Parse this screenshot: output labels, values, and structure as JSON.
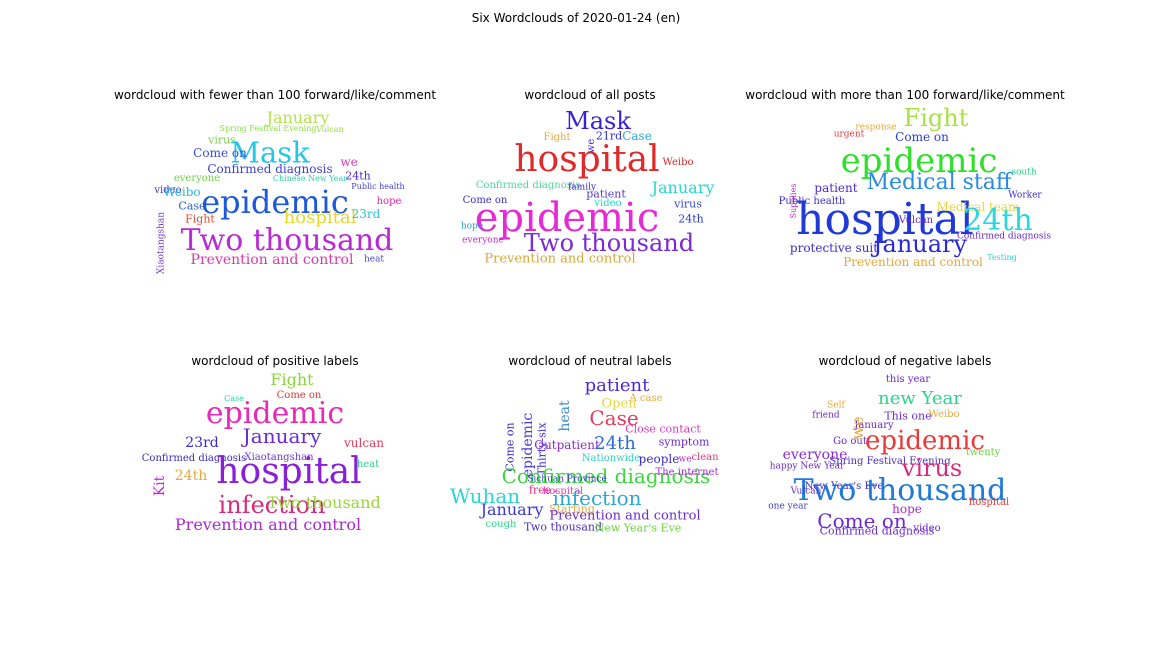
{
  "figure_title": "Six Wordclouds of 2020-01-24 (en)",
  "panels": [
    {
      "title": "wordcloud with fewer than 100 forward/like/comment",
      "words": [
        {
          "text": "January",
          "color": "#b5e34a"
        },
        {
          "text": "Spring Festival Evening",
          "color": "#8be04a"
        },
        {
          "text": "Vulcan",
          "color": "#9be03c"
        },
        {
          "text": "virus",
          "color": "#7ed050"
        },
        {
          "text": "Mask",
          "color": "#22c7e6"
        },
        {
          "text": "Come on",
          "color": "#3a4bd8"
        },
        {
          "text": "Confirmed diagnosis",
          "color": "#3b3fd0"
        },
        {
          "text": "video",
          "color": "#3c2fd0"
        },
        {
          "text": "everyone",
          "color": "#6fd64a"
        },
        {
          "text": "Weibo",
          "color": "#26b8e8"
        },
        {
          "text": "Case",
          "color": "#2a62d6"
        },
        {
          "text": "epidemic",
          "color": "#1f58d8"
        },
        {
          "text": "24th",
          "color": "#4a2bd0"
        },
        {
          "text": "Public health",
          "color": "#3f3fc8"
        },
        {
          "text": "Chinese New Year",
          "color": "#2ed0a8"
        },
        {
          "text": "Fight",
          "color": "#e64a2e"
        },
        {
          "text": "hospital",
          "color": "#e8d62a"
        },
        {
          "text": "23rd",
          "color": "#2fc2d8"
        },
        {
          "text": "hope",
          "color": "#e62aa8"
        },
        {
          "text": "Two thousand",
          "color": "#b82ad6"
        },
        {
          "text": "Prevention and control",
          "color": "#d83aa8"
        },
        {
          "text": "Xiaotangshan",
          "color": "#6a3ad0"
        },
        {
          "text": "we",
          "color": "#d83ab8"
        },
        {
          "text": "heat",
          "color": "#4a4ad0"
        }
      ]
    },
    {
      "title": "wordcloud of all posts",
      "words": [
        {
          "text": "Mask",
          "color": "#3a1fd8"
        },
        {
          "text": "Fight",
          "color": "#e8a83a"
        },
        {
          "text": "21rd",
          "color": "#2a2ad8"
        },
        {
          "text": "Case",
          "color": "#2aa8e0"
        },
        {
          "text": "hospital",
          "color": "#e02a2a"
        },
        {
          "text": "Weibo",
          "color": "#e02a2a"
        },
        {
          "text": "Confirmed diagnosis",
          "color": "#4ad89a"
        },
        {
          "text": "patient",
          "color": "#5a3ad0"
        },
        {
          "text": "January",
          "color": "#2ad6d0"
        },
        {
          "text": "Come on",
          "color": "#3a2ad0"
        },
        {
          "text": "virus",
          "color": "#3a4ad8"
        },
        {
          "text": "epidemic",
          "color": "#e62ad6"
        },
        {
          "text": "24th",
          "color": "#2a3ad0"
        },
        {
          "text": "hope",
          "color": "#2a9ad8"
        },
        {
          "text": "everyone",
          "color": "#c82ad6"
        },
        {
          "text": "Two thousand",
          "color": "#7a2ad8"
        },
        {
          "text": "Prevention and control",
          "color": "#d8a83a"
        },
        {
          "text": "video",
          "color": "#2ad6c0"
        },
        {
          "text": "we",
          "color": "#4a2ad0"
        },
        {
          "text": "family",
          "color": "#3a2ad0"
        }
      ]
    },
    {
      "title": "wordcloud with more than 100 forward/like/comment",
      "words": [
        {
          "text": "Fight",
          "color": "#a8e04a"
        },
        {
          "text": "response",
          "color": "#e8a83a"
        },
        {
          "text": "urgent",
          "color": "#e83a3a"
        },
        {
          "text": "Come on",
          "color": "#2a3ad8"
        },
        {
          "text": "epidemic",
          "color": "#2ee02a"
        },
        {
          "text": "patient",
          "color": "#4a2ad8"
        },
        {
          "text": "Medical staff",
          "color": "#2a8ae0"
        },
        {
          "text": "Public health",
          "color": "#3a2ad0"
        },
        {
          "text": "hospital",
          "color": "#1f3ad8"
        },
        {
          "text": "Vulcan",
          "color": "#5a2ad0"
        },
        {
          "text": "Medical team",
          "color": "#e8d63a"
        },
        {
          "text": "24th",
          "color": "#2ad6e0"
        },
        {
          "text": "January",
          "color": "#2a2ad8"
        },
        {
          "text": "protective suit",
          "color": "#3a2ad0"
        },
        {
          "text": "Prevention and control",
          "color": "#e8a83a"
        },
        {
          "text": "Worker",
          "color": "#3a2ad0"
        },
        {
          "text": "Testing",
          "color": "#2ad6d0"
        },
        {
          "text": "south",
          "color": "#2ad68a"
        },
        {
          "text": "Supplies",
          "color": "#c82ad6"
        },
        {
          "text": "Confirmed diagnosis",
          "color": "#6a2ad0"
        }
      ]
    },
    {
      "title": "wordcloud of positive labels",
      "words": [
        {
          "text": "Fight",
          "color": "#8ad63a"
        },
        {
          "text": "Come on",
          "color": "#d83a3a"
        },
        {
          "text": "Case",
          "color": "#2ad6a8"
        },
        {
          "text": "epidemic",
          "color": "#e82ab8"
        },
        {
          "text": "January",
          "color": "#6a2ad8"
        },
        {
          "text": "23rd",
          "color": "#3a2ad0"
        },
        {
          "text": "vulcan",
          "color": "#e83a5a"
        },
        {
          "text": "Xiaotangshan",
          "color": "#6a3ad0"
        },
        {
          "text": "Confirmed diagnosis",
          "color": "#3a2ad0"
        },
        {
          "text": "24th",
          "color": "#e8a83a"
        },
        {
          "text": "hospital",
          "color": "#8a1fd8"
        },
        {
          "text": "Kit",
          "color": "#b82ad6"
        },
        {
          "text": "infection",
          "color": "#d82a7a"
        },
        {
          "text": "Two thousand",
          "color": "#9ad63a"
        },
        {
          "text": "Prevention and control",
          "color": "#a82ad6"
        },
        {
          "text": "heat",
          "color": "#2ad68a"
        }
      ]
    },
    {
      "title": "wordcloud of neutral labels",
      "words": [
        {
          "text": "patient",
          "color": "#4a2ad8"
        },
        {
          "text": "Open",
          "color": "#e8d63a"
        },
        {
          "text": "A case",
          "color": "#e8a83a"
        },
        {
          "text": "heat",
          "color": "#3a8ad0"
        },
        {
          "text": "epidemic",
          "color": "#4a3ad8"
        },
        {
          "text": "Thirty-six",
          "color": "#3a2ad0"
        },
        {
          "text": "Case",
          "color": "#e83a5a"
        },
        {
          "text": "Outpatient",
          "color": "#8a2ad6"
        },
        {
          "text": "Close contact",
          "color": "#d83ab8"
        },
        {
          "text": "24th",
          "color": "#2a6ad8"
        },
        {
          "text": "symptom",
          "color": "#6a2ad8"
        },
        {
          "text": "Come on",
          "color": "#3a2ad0"
        },
        {
          "text": "Nationwide",
          "color": "#2ad6c0"
        },
        {
          "text": "people",
          "color": "#3a2ad0"
        },
        {
          "text": "we",
          "color": "#b82ad6"
        },
        {
          "text": "clean",
          "color": "#e83a7a"
        },
        {
          "text": "Confirmed diagnosis",
          "color": "#3ad83a"
        },
        {
          "text": "The internet",
          "color": "#a82ad6"
        },
        {
          "text": "free",
          "color": "#e82a8a"
        },
        {
          "text": "hospital",
          "color": "#e83ab8"
        },
        {
          "text": "Wuhan",
          "color": "#2ad6d0"
        },
        {
          "text": "infection",
          "color": "#2aa8d8"
        },
        {
          "text": "January",
          "color": "#3a3ad0"
        },
        {
          "text": "Starting",
          "color": "#e8a83a"
        },
        {
          "text": "Prevention and control",
          "color": "#6a2ad8"
        },
        {
          "text": "cough",
          "color": "#2ad68a"
        },
        {
          "text": "Two thousand",
          "color": "#4a2ad0"
        },
        {
          "text": "New Year's Eve",
          "color": "#6ad63a"
        },
        {
          "text": "Sichuan Province",
          "color": "#3a3ad0"
        }
      ]
    },
    {
      "title": "wordcloud of negative labels",
      "words": [
        {
          "text": "this year",
          "color": "#6a2ad8"
        },
        {
          "text": "new Year",
          "color": "#2ad68a"
        },
        {
          "text": "This one",
          "color": "#6a2ad8"
        },
        {
          "text": "Weibo",
          "color": "#e8a83a"
        },
        {
          "text": "January",
          "color": "#6a2ad8"
        },
        {
          "text": "we",
          "color": "#e8a83a"
        },
        {
          "text": "epidemic",
          "color": "#e83a3a"
        },
        {
          "text": "everyone",
          "color": "#8a2ad6"
        },
        {
          "text": "Spring Festival Evening",
          "color": "#4a2ad0"
        },
        {
          "text": "virus",
          "color": "#d82a7a"
        },
        {
          "text": "twenty",
          "color": "#6ad63a"
        },
        {
          "text": "New Year's Eve",
          "color": "#4a2ad0"
        },
        {
          "text": "Two thousand",
          "color": "#1f7ad8"
        },
        {
          "text": "hope",
          "color": "#a82ad6"
        },
        {
          "text": "Come on",
          "color": "#6a2ad8"
        },
        {
          "text": "Confirmed diagnosis",
          "color": "#6a2ad0"
        },
        {
          "text": "video",
          "color": "#6a2ad0"
        },
        {
          "text": "one year",
          "color": "#3a3ad0"
        },
        {
          "text": "hospital",
          "color": "#e83a3a"
        },
        {
          "text": "Vulcan",
          "color": "#6a2ad0"
        },
        {
          "text": "friend",
          "color": "#6a2ad0"
        },
        {
          "text": "happy New Year",
          "color": "#6a2ad0"
        },
        {
          "text": "Go out",
          "color": "#6a2ad0"
        },
        {
          "text": "Self",
          "color": "#e8a83a"
        }
      ]
    }
  ]
}
